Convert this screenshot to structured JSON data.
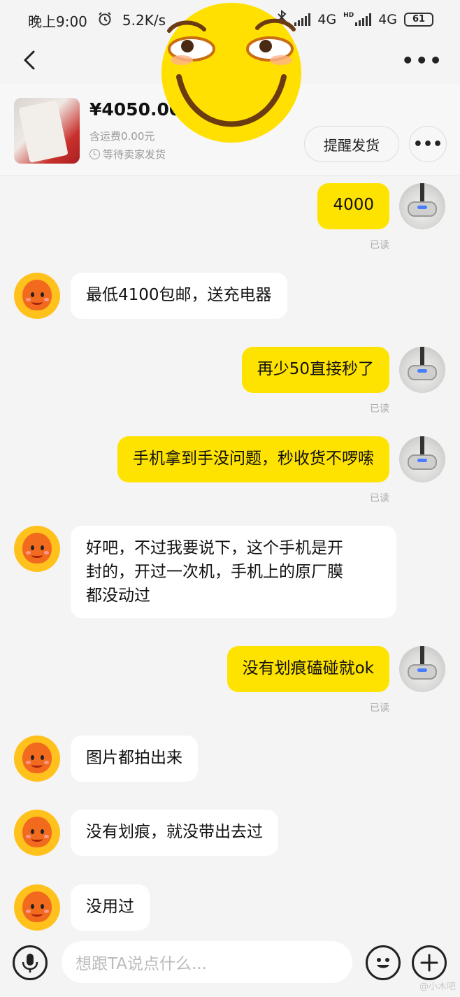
{
  "status_bar": {
    "time": "晚上9:00",
    "net_speed": "5.2K/s",
    "network1": "4G",
    "network2": "4G",
    "hd": "HD",
    "battery": "61"
  },
  "order": {
    "price": "¥4050.00",
    "shipping": "含运费0.00元",
    "status": "等待卖家发货",
    "remind_label": "提醒发货"
  },
  "messages": [
    {
      "side": "me",
      "text": "4000",
      "read": "已读"
    },
    {
      "side": "them",
      "text": "最低4100包邮，送充电器"
    },
    {
      "side": "me",
      "text": "再少50直接秒了",
      "read": "已读"
    },
    {
      "side": "me",
      "text": "手机拿到手没问题，秒收货不啰嗦",
      "read": "已读"
    },
    {
      "side": "them",
      "text": "好吧，不过我要说下，这个手机是开\n封的，开过一次机，手机上的原厂膜\n都没动过"
    },
    {
      "side": "me",
      "text": "没有划痕磕碰就ok",
      "read": "已读"
    },
    {
      "side": "them",
      "text": "图片都拍出来"
    },
    {
      "side": "them",
      "text": "没有划痕，就没带出去过"
    },
    {
      "side": "them",
      "text": "没用过"
    }
  ],
  "input": {
    "placeholder": "想跟TA说点什么..."
  },
  "watermark": "@小木吧",
  "colors": {
    "my_bubble": "#ffe300",
    "their_bubble": "#ffffff",
    "background": "#f4f4f4"
  }
}
